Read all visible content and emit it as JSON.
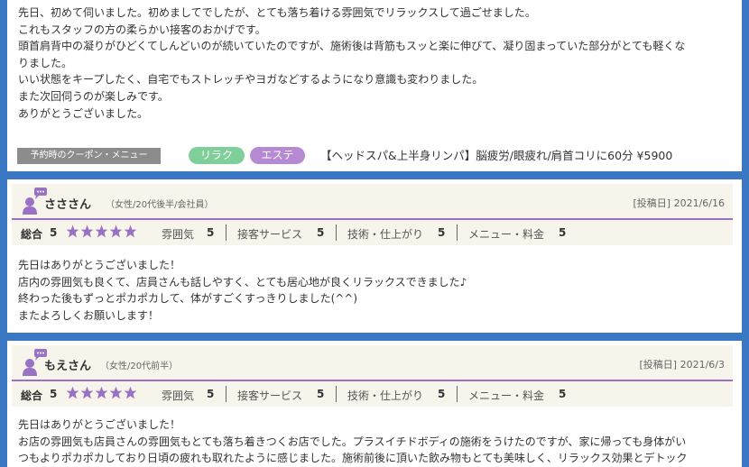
{
  "review_top": {
    "lines": [
      "先日、初めて伺いました。初めましてでしたが、とても落ち着ける雰囲気でリラックスして過ごせました。",
      "これもスタッフの方の柔らかい接客のおかげです。",
      "頭首肩背中の凝りがひどくてしんどいのが続いていたのですが、施術後は背筋もスッと楽に伸びて、凝り固まっていた部分がとても軽くな",
      "りました。",
      "いい状態をキープしたく、自宅でもストレッチやヨガなどするようになり意識も変わりました。",
      "また次回伺うのが楽しみです。",
      "ありがとうございました。"
    ],
    "coupon_tag": "予約時のクーポン・メニュー",
    "tags": [
      "リラク",
      "エステ"
    ],
    "coupon_desc": "【ヘッドスパ&上半身リンパ】脳疲労/眼疲れ/肩首コリに60分 ¥5900"
  },
  "reviews": [
    {
      "name": "さささん",
      "meta": "（女性/20代後半/会社員）",
      "posted": "[投稿日] 2021/6/16",
      "overall_label": "総合",
      "overall_value": "5",
      "stars": 5,
      "ratings": [
        {
          "label": "雰囲気",
          "value": "5"
        },
        {
          "label": "接客サービス",
          "value": "5"
        },
        {
          "label": "技術・仕上がり",
          "value": "5"
        },
        {
          "label": "メニュー・料金",
          "value": "5"
        }
      ],
      "lines": [
        "先日はありがとうございました！",
        "店内の雰囲気も良くて、店員さんも話しやすく、とても居心地が良くリラックスできました♪",
        "終わった後もずっとポカポカして、体がすごくすっきりしました(^^)",
        "またよろしくお願いします！"
      ]
    },
    {
      "name": "もえさん",
      "meta": "（女性/20代前半）",
      "posted": "[投稿日] 2021/6/3",
      "overall_label": "総合",
      "overall_value": "5",
      "stars": 5,
      "ratings": [
        {
          "label": "雰囲気",
          "value": "5"
        },
        {
          "label": "接客サービス",
          "value": "5"
        },
        {
          "label": "技術・仕上がり",
          "value": "5"
        },
        {
          "label": "メニュー・料金",
          "value": "5"
        }
      ],
      "lines": [
        "先日はありがとうございました！",
        "お店の雰囲気も店員さんの雰囲気もとても落ち着きつくお店でした。プラスイチドボディの施術をうけたのですが、家に帰っても身体がい",
        "つもよりポカポカしており日頃の疲れも取れたように感じました。施術前後に頂いた飲み物もとても美味しく、リラックス効果とデトック"
      ]
    }
  ],
  "colors": {
    "background": "#3b78c3",
    "header": "#f7f4ec",
    "accent_line": "#9a72c4",
    "star": "#9a72c4",
    "relax_pill": "#7fcf9b",
    "esthe_pill": "#b58ad3",
    "coupon_tag": "#8c8c8c"
  },
  "icons": {
    "avatar": "person-speech-icon",
    "star": "star-icon"
  }
}
